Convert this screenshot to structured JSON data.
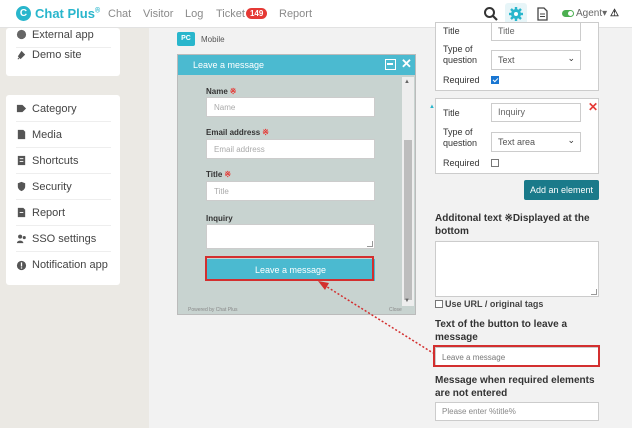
{
  "brand": {
    "name": "Chat Plus",
    "mark": "C"
  },
  "nav": {
    "items": [
      "Chat",
      "Visitor",
      "Log",
      "Ticket",
      "Report"
    ],
    "ticket_badge": "149",
    "agent_label": "Agent"
  },
  "sidebar": {
    "top_items": [
      "External app",
      "Demo site"
    ],
    "items": [
      "Category",
      "Media",
      "Shortcuts",
      "Security",
      "Report",
      "SSO settings",
      "Notification app"
    ]
  },
  "preview": {
    "pc_tag": "PC",
    "mode_label": "Mobile",
    "title": "Leave a message",
    "fields": [
      {
        "label": "Name",
        "placeholder": "Name"
      },
      {
        "label": "Email address",
        "placeholder": "Email address"
      },
      {
        "label": "Title",
        "placeholder": "Title"
      }
    ],
    "inquiry_label": "Inquiry",
    "submit_label": "Leave a message",
    "powered_by": "Powered by Chat Plus",
    "close_text": "Close"
  },
  "settings": {
    "element1": {
      "title_label": "Title",
      "title_value": "Title",
      "type_label_1": "Type of",
      "type_label_2": "question",
      "type_value": "Text",
      "required_label": "Required"
    },
    "element2": {
      "title_label": "Title",
      "title_value": "Inquiry",
      "type_label_1": "Type of",
      "type_label_2": "question",
      "type_value": "Text area",
      "required_label": "Required"
    },
    "add_element_label": "Add an element",
    "additional_text_heading_1": "Additonal text ※Displayed at the",
    "additional_text_heading_2": "bottom",
    "use_url_label": "Use URL / original tags",
    "button_text_heading_1": "Text of the button to leave a",
    "button_text_heading_2": "message",
    "button_text_value": "Leave a message",
    "required_msg_heading_1": "Message when required elements",
    "required_msg_heading_2": "are not entered",
    "required_msg_placeholder": "Please enter %title%"
  },
  "colors": {
    "accent": "#29b6cc",
    "widget_header": "#4bbad0",
    "highlight": "#d32f2f",
    "add_button": "#1a7a8a"
  }
}
